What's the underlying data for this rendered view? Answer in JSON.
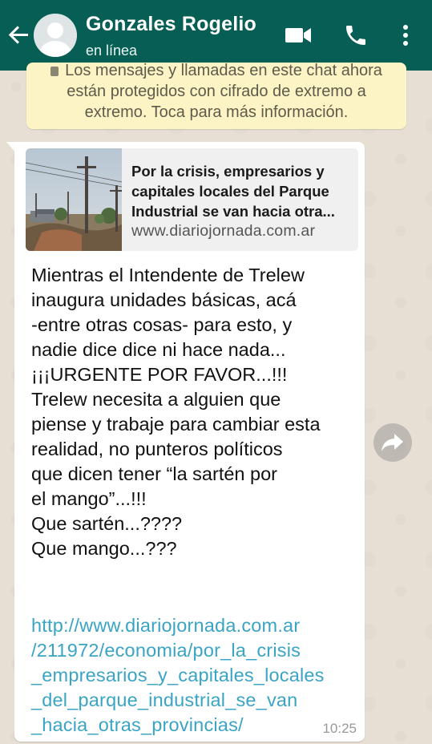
{
  "header": {
    "contact_name": "Gonzales Rogelio",
    "status": "en línea",
    "color": "#075e54",
    "icons": [
      "back-arrow-icon",
      "avatar",
      "video-call-icon",
      "phone-icon",
      "more-options-icon"
    ]
  },
  "encryption_notice": {
    "lines": [
      "Los mensajes y llamadas en este chat ahora",
      "están protegidos con cifrado de extremo a",
      "extremo. Toca para más información."
    ],
    "background": "#fdf4c5"
  },
  "message": {
    "link_preview": {
      "title_lines": [
        "Por la crisis, empresarios y",
        "capitales locales del  Parque",
        "Industrial se van hacia otra..."
      ],
      "domain": "www.diariojornada.com.ar"
    },
    "text_lines": [
      "Mientras el Intendente de Trelew",
      "inaugura unidades básicas, acá",
      "-entre otras cosas- para esto, y",
      "nadie dice dice ni hace nada...",
      "¡¡¡URGENTE POR FAVOR...!!!",
      "Trelew necesita a alguien que",
      "piense y trabaje para cambiar esta",
      "realidad, no punteros políticos",
      "que dicen tener “la sartén por",
      "el mango”...!!!",
      "Que sartén...????",
      "Que mango...???"
    ],
    "link_lines": [
      "http://www.diariojornada.com.ar",
      "/211972/economia/por_la_crisis",
      "_empresarios_y_capitales_locales",
      "_del_parque_industrial_se_van",
      "_hacia_otras_provincias/"
    ],
    "time": "10:25",
    "link_color": "#3aa4c5"
  },
  "forward_button": {
    "icon": "forward-icon"
  }
}
